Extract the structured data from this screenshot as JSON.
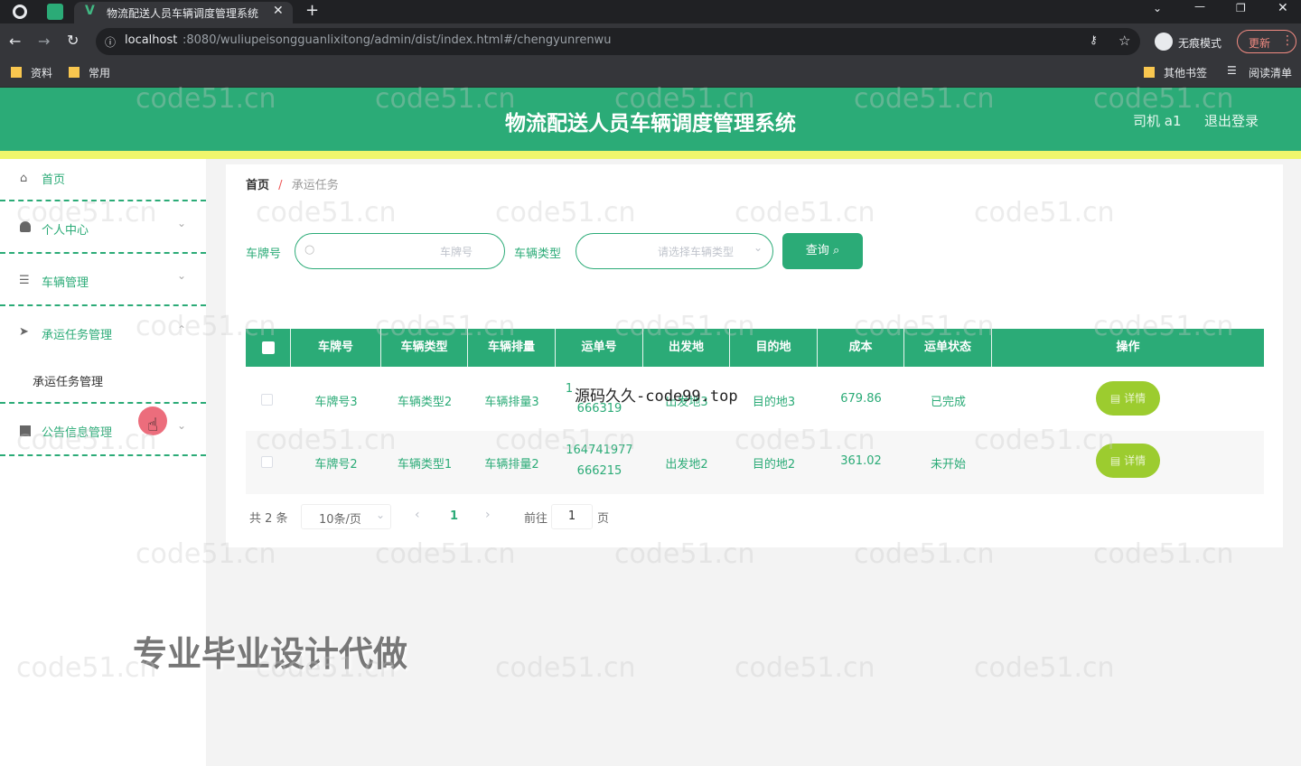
{
  "browser": {
    "tab_title": "物流配送人员车辆调度管理系统",
    "url_host": "localhost",
    "url_path": ":8080/wuliupeisongguanlixitong/admin/dist/index.html#/chengyunrenwu",
    "incognito_label": "无痕模式",
    "update_label": "更新",
    "bookmarks": [
      "资料",
      "常用"
    ],
    "other_bookmarks": "其他书签",
    "reading_list": "阅读清单"
  },
  "header": {
    "title": "物流配送人员车辆调度管理系统",
    "user_label": "司机 a1",
    "logout_label": "退出登录"
  },
  "sidebar": {
    "items": [
      {
        "label": "首页",
        "icon": "home-icon"
      },
      {
        "label": "个人中心",
        "icon": "user-icon"
      },
      {
        "label": "车辆管理",
        "icon": "list-icon"
      },
      {
        "label": "承运任务管理",
        "icon": "send-icon"
      },
      {
        "label": "承运任务管理"
      },
      {
        "label": "公告信息管理",
        "icon": "notice-icon"
      }
    ]
  },
  "breadcrumb": {
    "home": "首页",
    "separator": "/",
    "current": "承运任务"
  },
  "search": {
    "plate_label": "车牌号",
    "plate_placeholder": "车牌号",
    "type_label": "车辆类型",
    "type_placeholder": "请选择车辆类型",
    "query_button": "查询"
  },
  "table": {
    "headers": [
      "车牌号",
      "车辆类型",
      "车辆排量",
      "运单号",
      "出发地",
      "目的地",
      "成本",
      "运单状态",
      "操作"
    ],
    "rows": [
      {
        "plate": "车牌号3",
        "type": "车辆类型2",
        "displacement": "车辆排量3",
        "waybill_1": "1",
        "waybill_2": "666319",
        "origin": "出发地3",
        "dest": "目的地3",
        "cost": "679.86",
        "status": "已完成",
        "action": "详情"
      },
      {
        "plate": "车牌号2",
        "type": "车辆类型1",
        "displacement": "车辆排量2",
        "waybill_1": "164741977",
        "waybill_2": "666215",
        "origin": "出发地2",
        "dest": "目的地2",
        "cost": "361.02",
        "status": "未开始",
        "action": "详情"
      }
    ]
  },
  "pagination": {
    "total": "共 2 条",
    "page_size": "10条/页",
    "current": "1",
    "goto_label": "前往",
    "goto_value": "1",
    "page_suffix": "页"
  },
  "overlays": {
    "code_overlay": "源码久久-code99.top",
    "promo": "专业毕业设计代做",
    "watermark": "code51.cn"
  },
  "colors": {
    "brand": "#2bab77",
    "accent_yellow": "#f0f66c",
    "action_button": "#9ccc2f"
  }
}
